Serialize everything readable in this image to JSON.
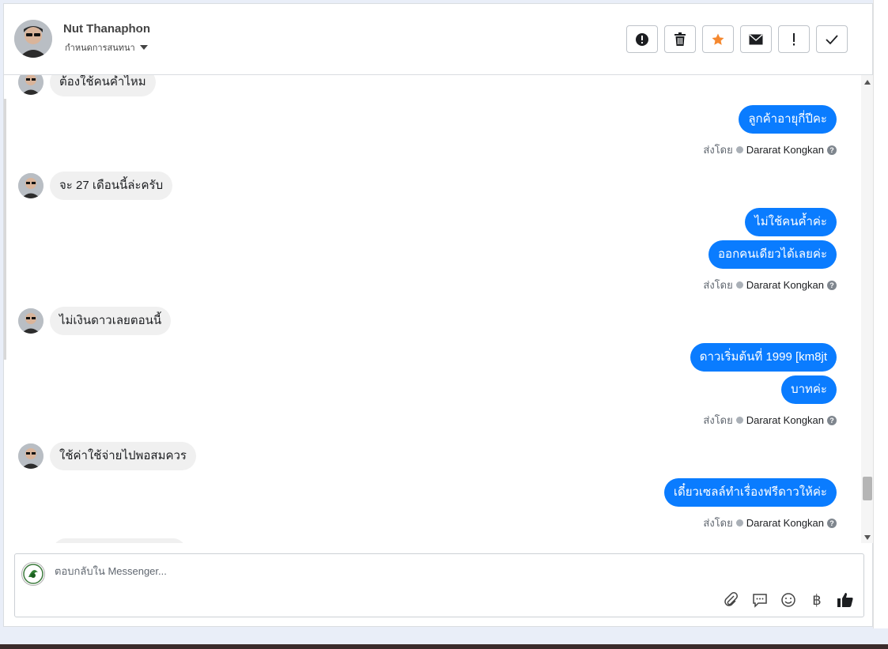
{
  "header": {
    "contact_name": "Nut Thanaphon",
    "assign_label": "กำหนดการสนทนา",
    "actions": [
      {
        "name": "spam-button",
        "icon": "alert-circle-icon"
      },
      {
        "name": "delete-button",
        "icon": "trash-icon"
      },
      {
        "name": "star-button",
        "icon": "star-icon",
        "color": "#f5882f"
      },
      {
        "name": "mark-unread-button",
        "icon": "envelope-icon"
      },
      {
        "name": "follow-up-button",
        "icon": "exclamation-icon"
      },
      {
        "name": "done-button",
        "icon": "check-icon"
      }
    ]
  },
  "thread": {
    "messages": [
      {
        "dir": "in",
        "text": "ต้องใช้คนค้ำไหม"
      },
      {
        "dir": "out",
        "text": "ลูกค้าอายุกี่ปีคะ"
      },
      {
        "dir": "meta",
        "prefix": "ส่งโดย",
        "agent": "Dararat Kongkan"
      },
      {
        "dir": "in",
        "text": "จะ 27 เดือนนี้ล่ะครับ"
      },
      {
        "dir": "out",
        "text": "ไม่ใช้คนค้ำค่ะ"
      },
      {
        "dir": "out",
        "text": "ออกคนเดียวได้เลยค่ะ"
      },
      {
        "dir": "meta",
        "prefix": "ส่งโดย",
        "agent": "Dararat Kongkan"
      },
      {
        "dir": "in",
        "text": "ไม่เงินดาวเลยตอนนี้"
      },
      {
        "dir": "out",
        "text": "ดาวเริ่มต้นที่ 1999 [km8jt"
      },
      {
        "dir": "out",
        "text": "บาทค่ะ"
      },
      {
        "dir": "meta",
        "prefix": "ส่งโดย",
        "agent": "Dararat Kongkan"
      },
      {
        "dir": "in",
        "text": "ใช้ค่าใช้จ่ายไปพอสมควร"
      },
      {
        "dir": "out",
        "text": "เดี๋ยวเซลล์ทำเรื่องฟรีดาวให้ค่ะ"
      },
      {
        "dir": "meta",
        "prefix": "ส่งโดย",
        "agent": "Dararat Kongkan"
      }
    ]
  },
  "composer": {
    "placeholder": "ตอบกลับใน Messenger...",
    "tools": [
      "paperclip-icon",
      "quick-reply-icon",
      "emoji-icon",
      "baht-icon",
      "thumbs-up-icon"
    ],
    "baht_symbol": "฿"
  },
  "colors": {
    "outgoing_bubble": "#0a7cff",
    "incoming_bubble": "#f0f0f0",
    "star": "#f5882f"
  }
}
